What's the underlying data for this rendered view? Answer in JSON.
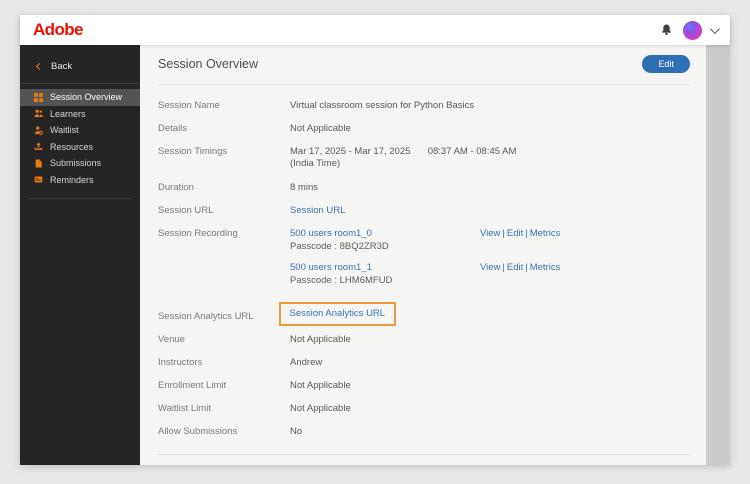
{
  "topbar": {
    "logo_text": "Adobe"
  },
  "sidebar": {
    "back_label": "Back",
    "items": [
      {
        "label": "Session Overview",
        "icon": "overview-grid-icon",
        "selected": true
      },
      {
        "label": "Learners",
        "icon": "learners-icon",
        "selected": false
      },
      {
        "label": "Waitlist",
        "icon": "waitlist-icon",
        "selected": false
      },
      {
        "label": "Resources",
        "icon": "resources-icon",
        "selected": false
      },
      {
        "label": "Submissions",
        "icon": "submissions-icon",
        "selected": false
      },
      {
        "label": "Reminders",
        "icon": "reminders-icon",
        "selected": false
      }
    ]
  },
  "main": {
    "title": "Session Overview",
    "edit_button_label": "Edit",
    "rows": {
      "session_name": {
        "label": "Session Name",
        "value": "Virtual classroom session for Python Basics"
      },
      "details": {
        "label": "Details",
        "value": "Not Applicable"
      },
      "session_timings": {
        "label": "Session Timings",
        "date_range": "Mar 17, 2025 - Mar 17, 2025",
        "time_range": "08:37 AM - 08:45 AM",
        "timezone": "(India Time)"
      },
      "duration": {
        "label": "Duration",
        "value": "8 mins"
      },
      "session_url": {
        "label": "Session URL",
        "link_label": "Session URL"
      },
      "session_recording": {
        "label": "Session Recording",
        "separator": "|",
        "recordings": [
          {
            "title": "500 users room1_0",
            "passcode": "Passcode : 8BQ2ZR3D",
            "actions": {
              "view": "View",
              "edit": "Edit",
              "metrics": "Metrics"
            }
          },
          {
            "title": "500 users room1_1",
            "passcode": "Passcode : LHM6MFUD",
            "actions": {
              "view": "View",
              "edit": "Edit",
              "metrics": "Metrics"
            }
          }
        ]
      },
      "session_analytics_url": {
        "label": "Session Analytics URL",
        "link_label": "Session Analytics URL",
        "highlighted": true
      },
      "venue": {
        "label": "Venue",
        "value": "Not Applicable"
      },
      "instructors": {
        "label": "Instructors",
        "value": "Andrew"
      },
      "enrollment_limit": {
        "label": "Enrollment Limit",
        "value": "Not Applicable"
      },
      "waitlist_limit": {
        "label": "Waitlist Limit",
        "value": "Not Applicable"
      },
      "allow_submissions": {
        "label": "Allow Submissions",
        "value": "No"
      }
    }
  },
  "colors": {
    "adobe_red": "#eb1000",
    "sidebar_bg": "#252525",
    "sidebar_selected_bg": "#535353",
    "icon_orange": "#ed7b12",
    "accent_blue_button": "#2d6fb3",
    "link_blue": "#3a72ac",
    "highlight_orange_border": "#e89a3c",
    "main_bg": "#f5f5f4"
  }
}
